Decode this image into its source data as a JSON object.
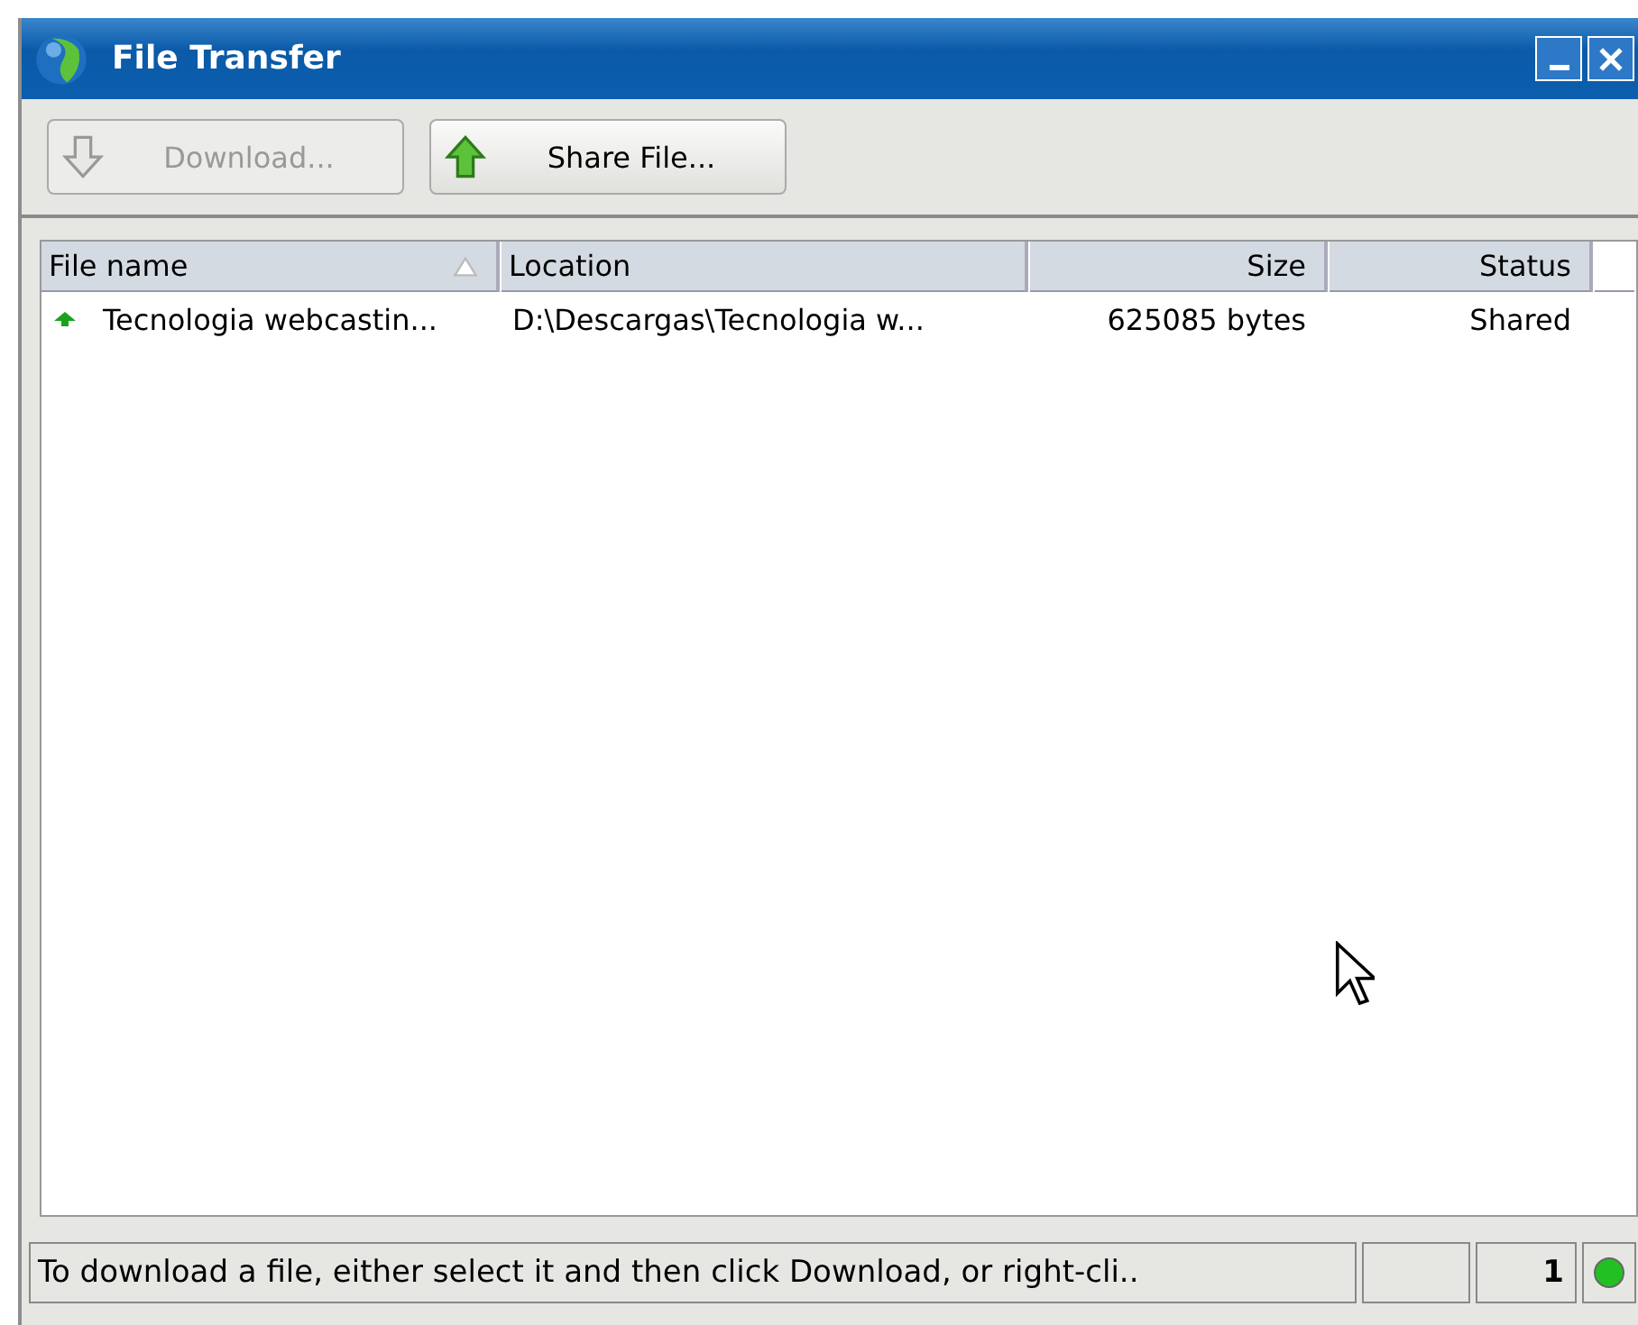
{
  "window": {
    "title": "File Transfer"
  },
  "toolbar": [
    {
      "label": "Download...",
      "kind": "download",
      "disabled": true
    },
    {
      "label": "Share File...",
      "kind": "share",
      "disabled": false
    }
  ],
  "table": {
    "columns": [
      {
        "label": "File name",
        "sorted": true
      },
      {
        "label": "Location",
        "sorted": false
      },
      {
        "label": "Size",
        "sorted": false
      },
      {
        "label": "Status",
        "sorted": false
      }
    ],
    "rows": [
      {
        "cells": [
          "Tecnologia webcastin...",
          "D:\\Descargas\\Tecnologia w...",
          "625085 bytes",
          "Shared"
        ],
        "kind": "upload"
      }
    ]
  },
  "status_bar": {
    "message": "To download a file, either select it and then click Download, or right-cli..",
    "count": "1",
    "online": true
  }
}
